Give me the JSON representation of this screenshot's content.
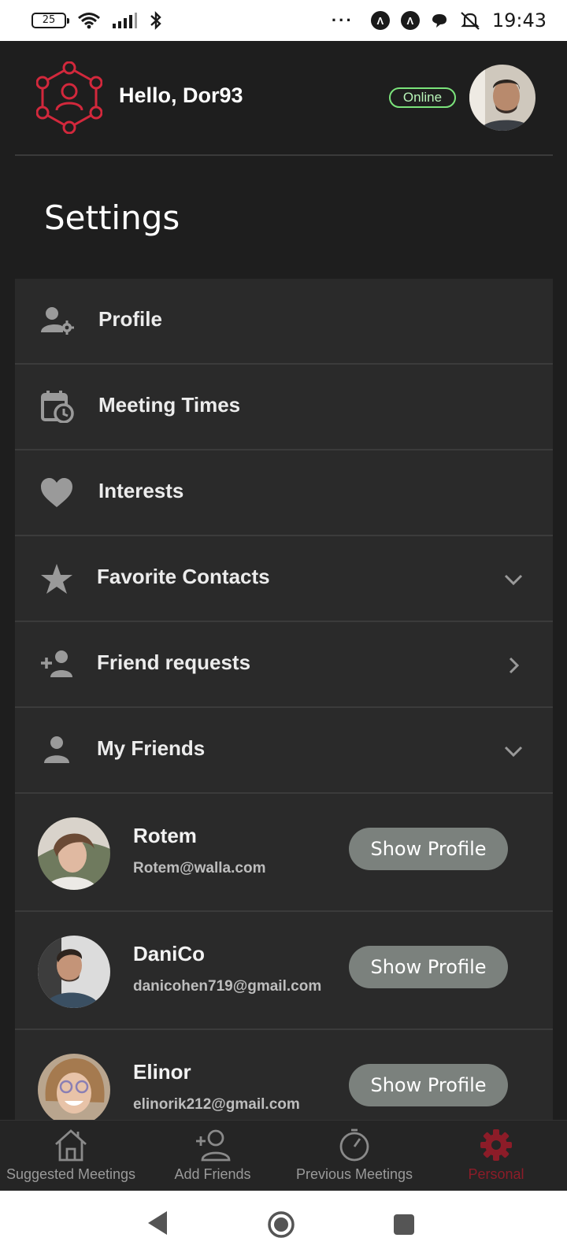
{
  "status_bar": {
    "battery": "25",
    "time": "19:43",
    "icons": [
      "wifi-icon",
      "signal-icon",
      "bluetooth-icon",
      "more-dots-icon",
      "app-a-icon",
      "app-a-icon",
      "chat-icon",
      "mute-alarm-icon"
    ]
  },
  "header": {
    "greeting": "Hello, Dor93",
    "status_badge": "Online",
    "logo_icon": "network-person-logo",
    "colors": {
      "logo": "#d2283c",
      "online": "#7be37b"
    }
  },
  "page": {
    "title": "Settings"
  },
  "settings": {
    "items": [
      {
        "label": "Profile",
        "icon": "user-gear-icon"
      },
      {
        "label": "Meeting Times",
        "icon": "calendar-clock-icon"
      },
      {
        "label": "Interests",
        "icon": "heart-icon"
      },
      {
        "label": "Favorite Contacts",
        "icon": "star-icon",
        "chevron": "chevron-down-icon"
      },
      {
        "label": "Friend requests",
        "icon": "add-person-icon",
        "chevron": "chevron-right-icon"
      },
      {
        "label": "My Friends",
        "icon": "person-icon",
        "chevron": "chevron-down-icon"
      }
    ]
  },
  "friends": [
    {
      "name": "Rotem",
      "email": "Rotem@walla.com",
      "button": "Show Profile"
    },
    {
      "name": "DaniCo",
      "email": "danicohen719@gmail.com",
      "button": "Show Profile"
    },
    {
      "name": "Elinor",
      "email": "elinorik212@gmail.com",
      "button": "Show Profile"
    }
  ],
  "bottom_nav": {
    "items": [
      {
        "label": "Suggested Meetings",
        "icon": "home-icon"
      },
      {
        "label": "Add Friends",
        "icon": "add-person-outline-icon"
      },
      {
        "label": "Previous Meetings",
        "icon": "timer-icon"
      },
      {
        "label": "Personal",
        "icon": "gear-icon",
        "active": true
      }
    ],
    "active_color": "#8c1c28"
  }
}
